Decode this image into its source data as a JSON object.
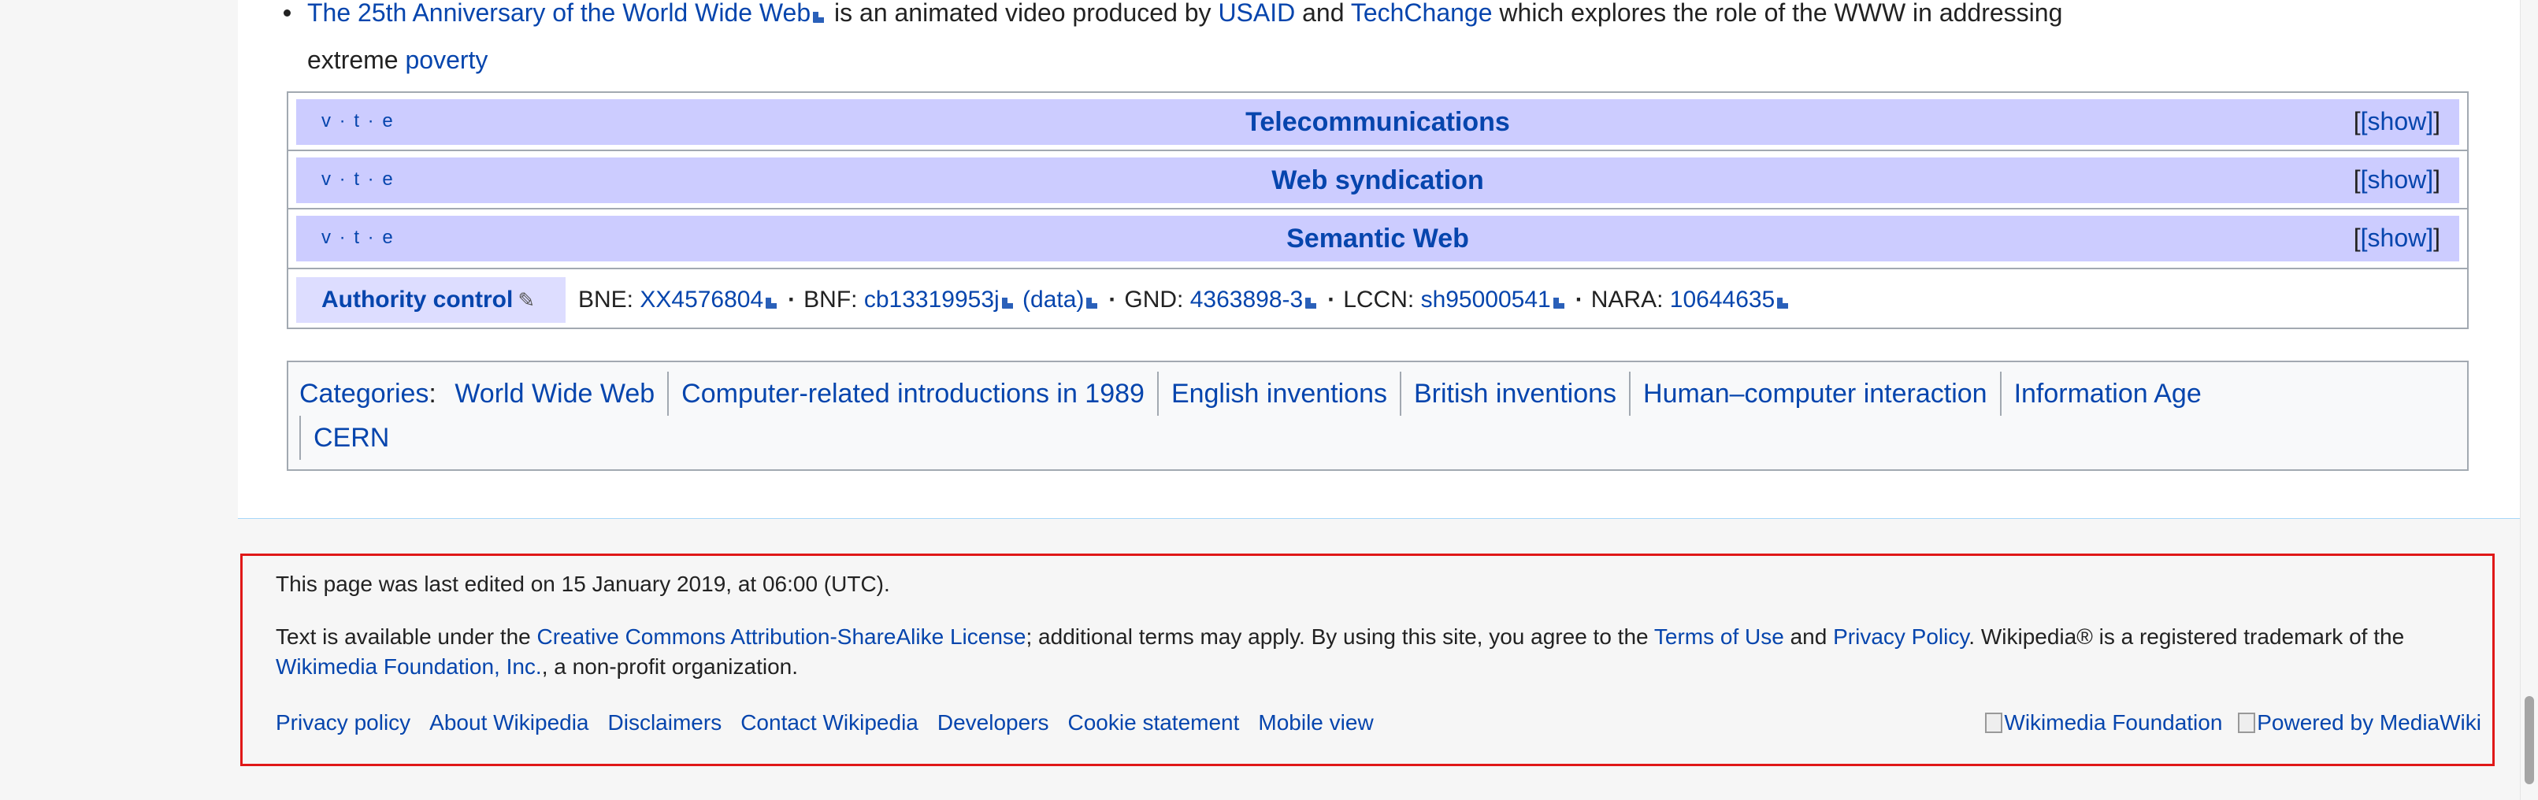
{
  "bullet": {
    "link1": "The 25th Anniversary of the World Wide Web",
    "text1": " is an animated video produced by ",
    "link2": "USAID",
    "text2": " and ",
    "link3": "TechChange",
    "text3": " which explores the role of the WWW in addressing",
    "text4": "extreme ",
    "link4": "poverty"
  },
  "navboxes": [
    {
      "vte": "v · t · e",
      "title": "Telecommunications",
      "toggle": "[show]"
    },
    {
      "vte": "v · t · e",
      "title": "Web syndication",
      "toggle": "[show]"
    },
    {
      "vte": "v · t · e",
      "title": "Semantic Web",
      "toggle": "[show]"
    }
  ],
  "authority": {
    "label": "Authority control",
    "edit_icon": "pencil-icon",
    "items": [
      {
        "key": "BNE: ",
        "val": "XX4576804"
      },
      {
        "key": "BNF: ",
        "val": "cb13319953j",
        "extra": "(data)"
      },
      {
        "key": "GND: ",
        "val": "4363898-3"
      },
      {
        "key": "LCCN: ",
        "val": "sh95000541"
      },
      {
        "key": "NARA: ",
        "val": "10644635"
      }
    ]
  },
  "categories": {
    "label": "Categories",
    "items": [
      "World Wide Web",
      "Computer-related introductions in 1989",
      "English inventions",
      "British inventions",
      "Human–computer interaction",
      "Information Age",
      "CERN"
    ]
  },
  "footer": {
    "lastmod": "This page was last edited on 15 January 2019, at 06:00 (UTC).",
    "license_1": "Text is available under the ",
    "license_link": "Creative Commons Attribution-ShareAlike License",
    "license_2": "; additional terms may apply. By using this site, you agree to the ",
    "terms_link": "Terms of Use",
    "license_3": " and ",
    "privacy_link": "Privacy Policy",
    "license_4": ". Wikipedia® is a registered trademark of the ",
    "wmf_link": "Wikimedia Foundation, Inc.",
    "license_5": ", a non-profit organization.",
    "places": [
      "Privacy policy",
      "About Wikipedia",
      "Disclaimers",
      "Contact Wikipedia",
      "Developers",
      "Cookie statement",
      "Mobile view"
    ],
    "icons": [
      "Wikimedia Foundation",
      "Powered by MediaWiki"
    ]
  }
}
